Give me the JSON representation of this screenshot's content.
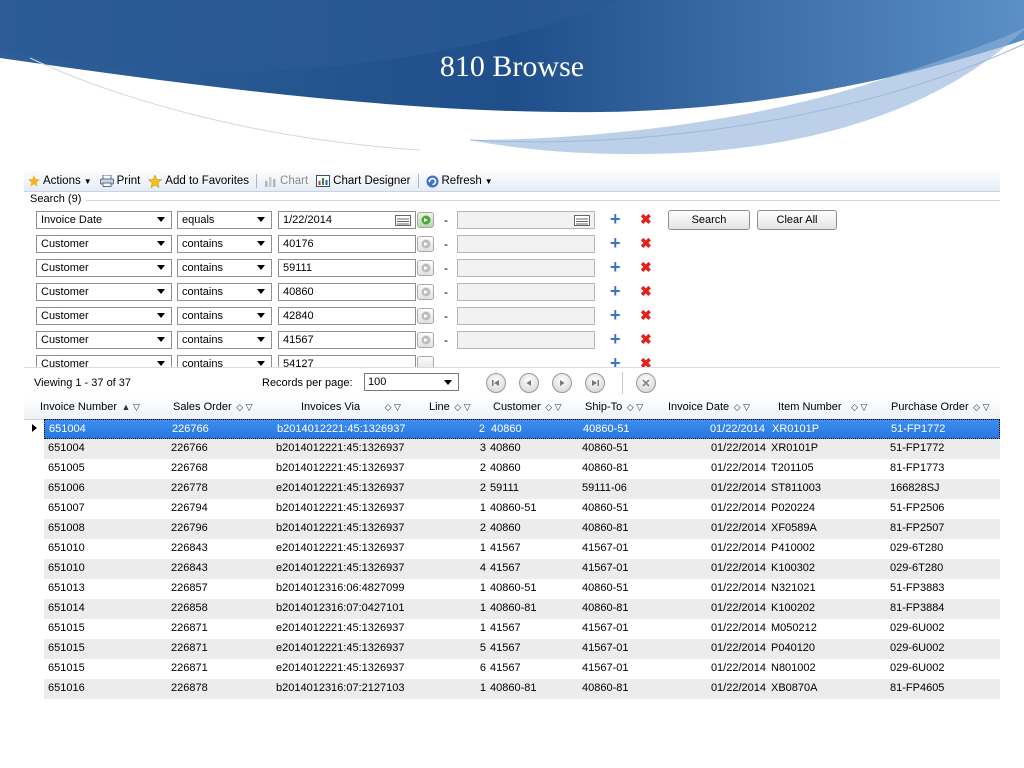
{
  "slide": {
    "title": "810 Browse"
  },
  "toolbar": {
    "actions": "Actions",
    "print": "Print",
    "favorites": "Add to Favorites",
    "chart": "Chart",
    "chart_designer": "Chart Designer",
    "refresh": "Refresh"
  },
  "search": {
    "label": "Search (9)",
    "search_button": "Search",
    "clear_button": "Clear All",
    "rows": [
      {
        "field": "Invoice Date",
        "operator": "equals",
        "value": "1/22/2014",
        "value2": ""
      },
      {
        "field": "Customer",
        "operator": "contains",
        "value": "40176",
        "value2": ""
      },
      {
        "field": "Customer",
        "operator": "contains",
        "value": "59111",
        "value2": ""
      },
      {
        "field": "Customer",
        "operator": "contains",
        "value": "40860",
        "value2": ""
      },
      {
        "field": "Customer",
        "operator": "contains",
        "value": "42840",
        "value2": ""
      },
      {
        "field": "Customer",
        "operator": "contains",
        "value": "41567",
        "value2": ""
      },
      {
        "field": "Customer",
        "operator": "contains",
        "value": "54127",
        "value2": ""
      }
    ]
  },
  "pager": {
    "viewing": "Viewing  1 - 37  of  37",
    "rpp_label": "Records per page:",
    "rpp_value": "100"
  },
  "grid": {
    "columns": [
      "Invoice Number",
      "Sales Order",
      "Invoices Via",
      "Line",
      "Customer",
      "Ship-To",
      "Invoice Date",
      "Item Number",
      "Purchase Order"
    ],
    "rows": [
      [
        "651004",
        "226766",
        "b2014012221:45:1326937",
        "2",
        "40860",
        "40860-51",
        "01/22/2014",
        "XR0101P",
        "51-FP1772"
      ],
      [
        "651004",
        "226766",
        "b2014012221:45:1326937",
        "3",
        "40860",
        "40860-51",
        "01/22/2014",
        "XR0101P",
        "51-FP1772"
      ],
      [
        "651005",
        "226768",
        "b2014012221:45:1326937",
        "2",
        "40860",
        "40860-81",
        "01/22/2014",
        "T201105",
        "81-FP1773"
      ],
      [
        "651006",
        "226778",
        "e2014012221:45:1326937",
        "2",
        "59111",
        "59111-06",
        "01/22/2014",
        "ST811003",
        "166828SJ"
      ],
      [
        "651007",
        "226794",
        "b2014012221:45:1326937",
        "1",
        "40860-51",
        "40860-51",
        "01/22/2014",
        "P020224",
        "51-FP2506"
      ],
      [
        "651008",
        "226796",
        "b2014012221:45:1326937",
        "2",
        "40860",
        "40860-81",
        "01/22/2014",
        "XF0589A",
        "81-FP2507"
      ],
      [
        "651010",
        "226843",
        "e2014012221:45:1326937",
        "1",
        "41567",
        "41567-01",
        "01/22/2014",
        "P410002",
        "029-6T280"
      ],
      [
        "651010",
        "226843",
        "e2014012221:45:1326937",
        "4",
        "41567",
        "41567-01",
        "01/22/2014",
        "K100302",
        "029-6T280"
      ],
      [
        "651013",
        "226857",
        "b2014012316:06:4827099",
        "1",
        "40860-51",
        "40860-51",
        "01/22/2014",
        "N321021",
        "51-FP3883"
      ],
      [
        "651014",
        "226858",
        "b2014012316:07:0427101",
        "1",
        "40860-81",
        "40860-81",
        "01/22/2014",
        "K100202",
        "81-FP3884"
      ],
      [
        "651015",
        "226871",
        "e2014012221:45:1326937",
        "1",
        "41567",
        "41567-01",
        "01/22/2014",
        "M050212",
        "029-6U002"
      ],
      [
        "651015",
        "226871",
        "e2014012221:45:1326937",
        "5",
        "41567",
        "41567-01",
        "01/22/2014",
        "P040120",
        "029-6U002"
      ],
      [
        "651015",
        "226871",
        "e2014012221:45:1326937",
        "6",
        "41567",
        "41567-01",
        "01/22/2014",
        "N801002",
        "029-6U002"
      ],
      [
        "651016",
        "226878",
        "b2014012316:07:2127103",
        "1",
        "40860-81",
        "40860-81",
        "01/22/2014",
        "XB0870A",
        "81-FP4605"
      ]
    ]
  }
}
